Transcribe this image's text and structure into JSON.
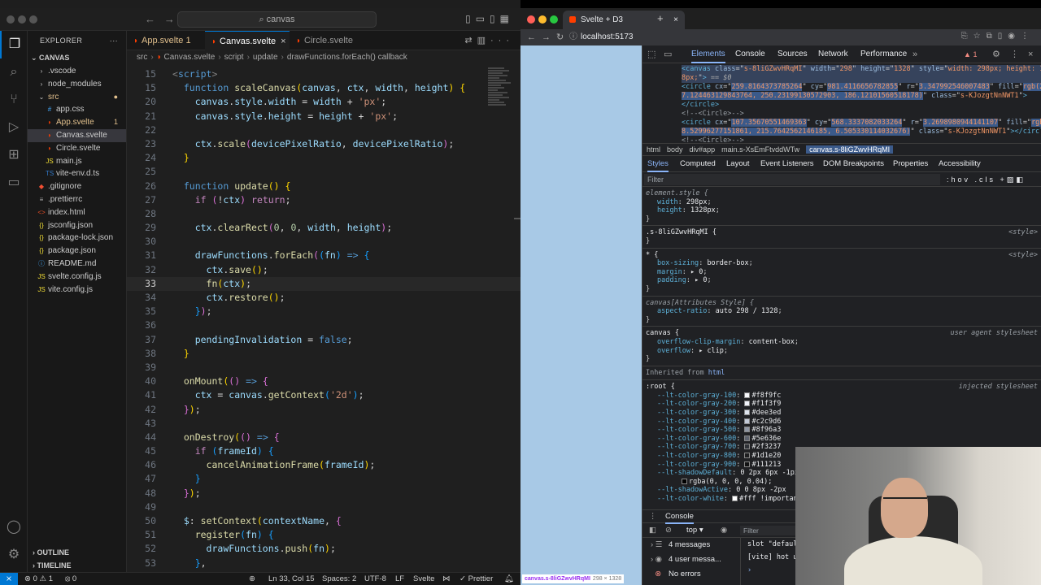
{
  "vscode": {
    "search_placeholder": "canvas",
    "explorer_title": "EXPLORER",
    "project": "CANVAS",
    "tree": [
      {
        "label": ".vscode",
        "kind": "folder",
        "depth": 1
      },
      {
        "label": "node_modules",
        "kind": "folder",
        "depth": 1
      },
      {
        "label": "src",
        "kind": "folder-open",
        "depth": 1,
        "modified": true
      },
      {
        "label": "app.css",
        "kind": "css",
        "depth": 2
      },
      {
        "label": "App.svelte",
        "kind": "svelte",
        "depth": 2,
        "badge": "1",
        "modified": true
      },
      {
        "label": "Canvas.svelte",
        "kind": "svelte",
        "depth": 2,
        "selected": true
      },
      {
        "label": "Circle.svelte",
        "kind": "svelte",
        "depth": 2
      },
      {
        "label": "main.js",
        "kind": "js",
        "depth": 2
      },
      {
        "label": "vite-env.d.ts",
        "kind": "ts",
        "depth": 2
      },
      {
        "label": ".gitignore",
        "kind": "git",
        "depth": 1
      },
      {
        "label": ".prettierrc",
        "kind": "cfg",
        "depth": 1
      },
      {
        "label": "index.html",
        "kind": "html",
        "depth": 1
      },
      {
        "label": "jsconfig.json",
        "kind": "json",
        "depth": 1
      },
      {
        "label": "package-lock.json",
        "kind": "json",
        "depth": 1
      },
      {
        "label": "package.json",
        "kind": "json",
        "depth": 1
      },
      {
        "label": "README.md",
        "kind": "md",
        "depth": 1
      },
      {
        "label": "svelte.config.js",
        "kind": "js",
        "depth": 1
      },
      {
        "label": "vite.config.js",
        "kind": "js",
        "depth": 1
      }
    ],
    "outline": "OUTLINE",
    "timeline": "TIMELINE",
    "tabs": [
      {
        "label": "App.svelte 1",
        "active": false
      },
      {
        "label": "Canvas.svelte",
        "active": true
      },
      {
        "label": "Circle.svelte",
        "active": false
      }
    ],
    "breadcrumbs": [
      "src",
      "Canvas.svelte",
      "script",
      "update",
      "drawFunctions.forEach() callback"
    ],
    "code": [
      {
        "n": "15",
        "html": "<span class=\"t-tag\">&lt;</span><span class=\"t-tagn\">script</span><span class=\"t-tag\">&gt;</span>",
        "indent": 0
      },
      {
        "n": "15",
        "html": "  <span class=\"t-bl\">function</span> <span class=\"t-fn\">scaleCanvas</span><span class=\"t-br1\">(</span><span class=\"t-var\">canvas</span>, <span class=\"t-var\">ctx</span>, <span class=\"t-var\">width</span>, <span class=\"t-var\">height</span><span class=\"t-br1\">)</span> <span class=\"t-br1\">{</span>"
      },
      {
        "n": "20",
        "html": "    <span class=\"t-var\">canvas</span>.<span class=\"t-var\">style</span>.<span class=\"t-var\">width</span> = <span class=\"t-var\">width</span> + <span class=\"t-str\">'px'</span>;"
      },
      {
        "n": "21",
        "html": "    <span class=\"t-var\">canvas</span>.<span class=\"t-var\">style</span>.<span class=\"t-var\">height</span> = <span class=\"t-var\">height</span> + <span class=\"t-str\">'px'</span>;"
      },
      {
        "n": "22",
        "html": ""
      },
      {
        "n": "23",
        "html": "    <span class=\"t-var\">ctx</span>.<span class=\"t-fn\">scale</span><span class=\"t-br2\">(</span><span class=\"t-var\">devicePixelRatio</span>, <span class=\"t-var\">devicePixelRatio</span><span class=\"t-br2\">)</span>;"
      },
      {
        "n": "24",
        "html": "  <span class=\"t-br1\">}</span>"
      },
      {
        "n": "25",
        "html": ""
      },
      {
        "n": "26",
        "html": "  <span class=\"t-bl\">function</span> <span class=\"t-fn\">update</span><span class=\"t-br1\">()</span> <span class=\"t-br1\">{</span>"
      },
      {
        "n": "27",
        "html": "    <span class=\"t-kw\">if</span> <span class=\"t-br2\">(</span>!<span class=\"t-var\">ctx</span><span class=\"t-br2\">)</span> <span class=\"t-kw\">return</span>;"
      },
      {
        "n": "28",
        "html": ""
      },
      {
        "n": "29",
        "html": "    <span class=\"t-var\">ctx</span>.<span class=\"t-fn\">clearRect</span><span class=\"t-br2\">(</span><span class=\"t-num\">0</span>, <span class=\"t-num\">0</span>, <span class=\"t-var\">width</span>, <span class=\"t-var\">height</span><span class=\"t-br2\">)</span>;"
      },
      {
        "n": "30",
        "html": ""
      },
      {
        "n": "31",
        "html": "    <span class=\"t-var\">drawFunctions</span>.<span class=\"t-fn\">forEach</span><span class=\"t-br2\">(</span><span class=\"t-br3\">(</span><span class=\"t-var\">fn</span><span class=\"t-br3\">)</span> <span class=\"t-bl\">=&gt;</span> <span class=\"t-br3\">{</span>"
      },
      {
        "n": "32",
        "html": "      <span class=\"t-var\">ctx</span>.<span class=\"t-fn\">save</span><span class=\"t-br1\">()</span>;"
      },
      {
        "n": "33",
        "html": "      <span class=\"t-fn\">fn</span><span class=\"t-br1\">(</span><span class=\"t-var\">ctx</span><span class=\"t-br1\">)</span>;",
        "current": true
      },
      {
        "n": "34",
        "html": "      <span class=\"t-var\">ctx</span>.<span class=\"t-fn\">restore</span><span class=\"t-br1\">()</span>;"
      },
      {
        "n": "35",
        "html": "    <span class=\"t-br3\">}</span><span class=\"t-br2\">)</span>;"
      },
      {
        "n": "36",
        "html": ""
      },
      {
        "n": "37",
        "html": "    <span class=\"t-var\">pendingInvalidation</span> = <span class=\"t-bl\">false</span>;"
      },
      {
        "n": "38",
        "html": "  <span class=\"t-br1\">}</span>"
      },
      {
        "n": "39",
        "html": ""
      },
      {
        "n": "40",
        "html": "  <span class=\"t-fn\">onMount</span><span class=\"t-br1\">(</span><span class=\"t-br2\">()</span> <span class=\"t-bl\">=&gt;</span> <span class=\"t-br2\">{</span>"
      },
      {
        "n": "41",
        "html": "    <span class=\"t-var\">ctx</span> = <span class=\"t-var\">canvas</span>.<span class=\"t-fn\">getContext</span><span class=\"t-br3\">(</span><span class=\"t-str\">'2d'</span><span class=\"t-br3\">)</span>;"
      },
      {
        "n": "42",
        "html": "  <span class=\"t-br2\">}</span><span class=\"t-br1\">)</span>;"
      },
      {
        "n": "43",
        "html": ""
      },
      {
        "n": "44",
        "html": "  <span class=\"t-fn\">onDestroy</span><span class=\"t-br1\">(</span><span class=\"t-br2\">()</span> <span class=\"t-bl\">=&gt;</span> <span class=\"t-br2\">{</span>"
      },
      {
        "n": "45",
        "html": "    <span class=\"t-kw\">if</span> <span class=\"t-br3\">(</span><span class=\"t-var\">frameId</span><span class=\"t-br3\">)</span> <span class=\"t-br3\">{</span>"
      },
      {
        "n": "46",
        "html": "      <span class=\"t-fn\">cancelAnimationFrame</span><span class=\"t-br1\">(</span><span class=\"t-var\">frameId</span><span class=\"t-br1\">)</span>;"
      },
      {
        "n": "47",
        "html": "    <span class=\"t-br3\">}</span>"
      },
      {
        "n": "48",
        "html": "  <span class=\"t-br2\">}</span><span class=\"t-br1\">)</span>;"
      },
      {
        "n": "49",
        "html": ""
      },
      {
        "n": "50",
        "html": "  <span class=\"t-var\">$</span>: <span class=\"t-fn\">setContext</span><span class=\"t-br1\">(</span><span class=\"t-var\">contextName</span>, <span class=\"t-br2\">{</span>"
      },
      {
        "n": "51",
        "html": "    <span class=\"t-fn\">register</span><span class=\"t-br3\">(</span><span class=\"t-var\">fn</span><span class=\"t-br3\">)</span> <span class=\"t-br3\">{</span>"
      },
      {
        "n": "52",
        "html": "      <span class=\"t-var\">drawFunctions</span>.<span class=\"t-fn\">push</span><span class=\"t-br1\">(</span><span class=\"t-var\">fn</span><span class=\"t-br1\">)</span>;"
      },
      {
        "n": "53",
        "html": "    <span class=\"t-br3\">}</span>,"
      }
    ],
    "status": {
      "errors": "0",
      "warnings": "1",
      "info": "0",
      "position": "Ln 33, Col 15",
      "spaces": "Spaces: 2",
      "encoding": "UTF-8",
      "eol": "LF",
      "language": "Svelte",
      "formatter": "Prettier"
    }
  },
  "chrome": {
    "tab_title": "Svelte + D3",
    "url": "localhost:5173",
    "page_label": "canvas.s-8liGZwvHRqMI",
    "page_label_size": "298 × 1328",
    "devtools_tabs": [
      "Elements",
      "Console",
      "Sources",
      "Network",
      "Performance"
    ],
    "warning_count": "1",
    "dom_lines": [
      "<span class=\"tn\">&lt;canvas</span> <span class=\"an\">class</span>=\"<span class=\"av\">s-8liGZwvHRqMI</span>\" <span class=\"an\">width</span>=\"<span class=\"av\">298</span>\" <span class=\"an\">height</span>=\"<span class=\"av\">1328</span>\" <span class=\"an\">style</span>=\"<span class=\"av\">width: 298px; height: 132</span>",
      "<span class=\"av\">8px;</span>\"<span class=\"tn\">&gt;</span> <span class=\"eq\">== $0</span>",
      "<span class=\"tn\">&lt;circle</span> <span class=\"an\">cx</span>=\"<span class=\"av sel\">259.8164373785264</span>\" <span class=\"an\">cy</span>=\"<span class=\"av sel\">981.4116656782855</span>\" <span class=\"an\">r</span>=\"<span class=\"av sel\">3.347992546007483</span>\" <span class=\"an\">fill</span>=\"<span class=\"av sel\">rgb(2</span>",
      "<span class=\"av sel\">7.124463129843764, 250.23199130572903, 186.12101560518178)</span>\" <span class=\"an\">class</span>=\"<span class=\"av\">s-KJozgtNnNWT1</span>\"<span class=\"tn\">&gt;</span>",
      "<span class=\"tn\">&lt;/circle&gt;</span>",
      "<span class=\"cm\">&lt;!--&lt;Circle&gt;--&gt;</span>",
      "<span class=\"tn\">&lt;circle</span> <span class=\"an\">cx</span>=\"<span class=\"av sel\">107.35670551469363</span>\" <span class=\"an\">cy</span>=\"<span class=\"av sel\">568.3337082033264</span>\" <span class=\"an\">r</span>=\"<span class=\"av sel\">3.2698980944141107</span>\" <span class=\"an\">fill</span>=\"<span class=\"av sel\">rgb(6</span>",
      "<span class=\"av sel\">8.52996277151861, 215.7642562146185, 6.505330114032676)</span>\" <span class=\"an\">class</span>=\"<span class=\"av\">s-KJozgtNnNWT1</span>\"<span class=\"tn\">&gt;&lt;/circle&gt;</span>",
      "<span class=\"cm\">&lt;!--&lt;Circle&gt;--&gt;</span>"
    ],
    "crumbs": [
      "html",
      "body",
      "div#app",
      "main.s-XsEmFtvddWTw",
      "canvas.s-8liGZwvHRqMI"
    ],
    "sub_tabs": [
      "Styles",
      "Computed",
      "Layout",
      "Event Listeners",
      "DOM Breakpoints",
      "Properties",
      "Accessibility"
    ],
    "filter_placeholder": "Filter",
    "filter_tools": ":hov .cls",
    "rules": [
      {
        "selector": "element.style {",
        "italic": true,
        "src": "",
        "props": [
          [
            "width",
            "298px"
          ],
          [
            "height",
            "1328px"
          ]
        ]
      },
      {
        "selector": ".s-8liGZwvHRqMI {",
        "italic": false,
        "src": "<style>",
        "props": []
      },
      {
        "selector": "* {",
        "italic": false,
        "src": "<style>",
        "props": [
          [
            "box-sizing",
            "border-box"
          ],
          [
            "margin",
            "▸ 0"
          ],
          [
            "padding",
            "▸ 0"
          ]
        ]
      },
      {
        "selector": "canvas[Attributes Style] {",
        "italic": true,
        "src": "",
        "props": [
          [
            "aspect-ratio",
            "auto 298 / 1328"
          ]
        ]
      },
      {
        "selector": "canvas {",
        "italic": false,
        "src": "user agent stylesheet",
        "props": [
          [
            "overflow-clip-margin",
            "content-box"
          ],
          [
            "overflow",
            "▸ clip"
          ]
        ]
      }
    ],
    "inherited_label": "Inherited from",
    "inherited_el": "html",
    "root_selector": ":root {",
    "root_src": "injected stylesheet",
    "root_props": [
      {
        "name": "--lt-color-gray-100",
        "value": "#f8f9fc",
        "swatch": "#f8f9fc"
      },
      {
        "name": "--lt-color-gray-200",
        "value": "#f1f3f9",
        "swatch": "#f1f3f9"
      },
      {
        "name": "--lt-color-gray-300",
        "value": "#dee3ed",
        "swatch": "#dee3ed"
      },
      {
        "name": "--lt-color-gray-400",
        "value": "#c2c9d6",
        "swatch": "#c2c9d6"
      },
      {
        "name": "--lt-color-gray-500",
        "value": "#8f96a3",
        "swatch": "#8f96a3"
      },
      {
        "name": "--lt-color-gray-600",
        "value": "#5e636e",
        "swatch": "#5e636e"
      },
      {
        "name": "--lt-color-gray-700",
        "value": "#2f3237",
        "swatch": "#2f3237"
      },
      {
        "name": "--lt-color-gray-800",
        "value": "#1d1e20",
        "swatch": "#1d1e20"
      },
      {
        "name": "--lt-color-gray-900",
        "value": "#111213",
        "swatch": "#111213"
      },
      {
        "name": "--lt-shadowDefault",
        "value": "0 2px 6px -1px",
        "swatch": ""
      },
      {
        "name": "",
        "value": "rgba(0, 0, 0, 0.04);",
        "swatch": "#000000"
      },
      {
        "name": "--lt-shadowActive",
        "value": "0 0 8px -2px",
        "swatch": ""
      },
      {
        "name": "--lt-color-white",
        "value": "#fff !important",
        "swatch": "#ffffff"
      }
    ],
    "drawer_tab": "Console",
    "console_context": "top ▾",
    "console_filter": "Filter",
    "console_groups": [
      {
        "icon": "☰",
        "label": "4 messages"
      },
      {
        "icon": "◉",
        "label": "4 user messa..."
      },
      {
        "icon": "⊗",
        "label": "No errors"
      }
    ],
    "console_lines": [
      "slot \"defaul",
      "[vite] hot u"
    ]
  }
}
